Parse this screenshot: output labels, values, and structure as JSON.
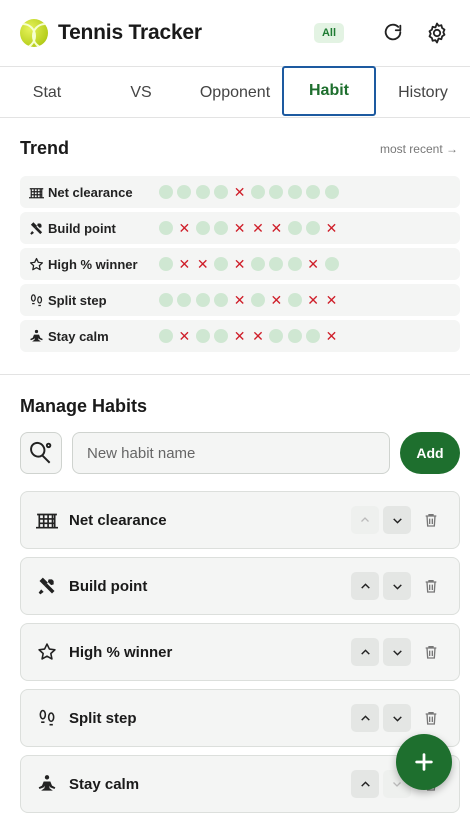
{
  "app": {
    "title": "Tennis Tracker",
    "filter_badge": "All"
  },
  "tabs": [
    {
      "label": "Stat",
      "active": false
    },
    {
      "label": "VS",
      "active": false
    },
    {
      "label": "Opponent",
      "active": false
    },
    {
      "label": "Habit",
      "active": true
    },
    {
      "label": "History",
      "active": false
    }
  ],
  "trend": {
    "title": "Trend",
    "hint": "most recent →",
    "rows": [
      {
        "label": "Net clearance",
        "icon": "net-icon",
        "marks": [
          "ok",
          "ok",
          "ok",
          "ok",
          "miss",
          "ok",
          "ok",
          "ok",
          "ok",
          "ok"
        ]
      },
      {
        "label": "Build point",
        "icon": "tools-icon",
        "marks": [
          "ok",
          "miss",
          "ok",
          "ok",
          "miss",
          "miss",
          "miss",
          "ok",
          "ok",
          "miss"
        ]
      },
      {
        "label": "High % winner",
        "icon": "star-icon",
        "marks": [
          "ok",
          "miss",
          "miss",
          "ok",
          "miss",
          "ok",
          "ok",
          "ok",
          "miss",
          "ok"
        ]
      },
      {
        "label": "Split step",
        "icon": "footprints-icon",
        "marks": [
          "ok",
          "ok",
          "ok",
          "ok",
          "miss",
          "ok",
          "miss",
          "ok",
          "miss",
          "miss"
        ]
      },
      {
        "label": "Stay calm",
        "icon": "meditate-icon",
        "marks": [
          "ok",
          "miss",
          "ok",
          "ok",
          "miss",
          "miss",
          "ok",
          "ok",
          "ok",
          "miss"
        ]
      }
    ]
  },
  "manage": {
    "title": "Manage Habits",
    "input_placeholder": "New habit name",
    "add_label": "Add",
    "habits": [
      {
        "label": "Net clearance",
        "icon": "net-icon",
        "up_disabled": true,
        "down_disabled": false
      },
      {
        "label": "Build point",
        "icon": "tools-icon",
        "up_disabled": false,
        "down_disabled": false
      },
      {
        "label": "High % winner",
        "icon": "star-icon",
        "up_disabled": false,
        "down_disabled": false
      },
      {
        "label": "Split step",
        "icon": "footprints-icon",
        "up_disabled": false,
        "down_disabled": false
      },
      {
        "label": "Stay calm",
        "icon": "meditate-icon",
        "up_disabled": false,
        "down_disabled": true
      }
    ]
  },
  "fab": {
    "icon": "plus-icon"
  },
  "colors": {
    "accent": "#1e6f2e",
    "ok_dot": "#cfe7d2",
    "miss": "#cf1f2a",
    "tab_outline": "#1d5aa0"
  }
}
